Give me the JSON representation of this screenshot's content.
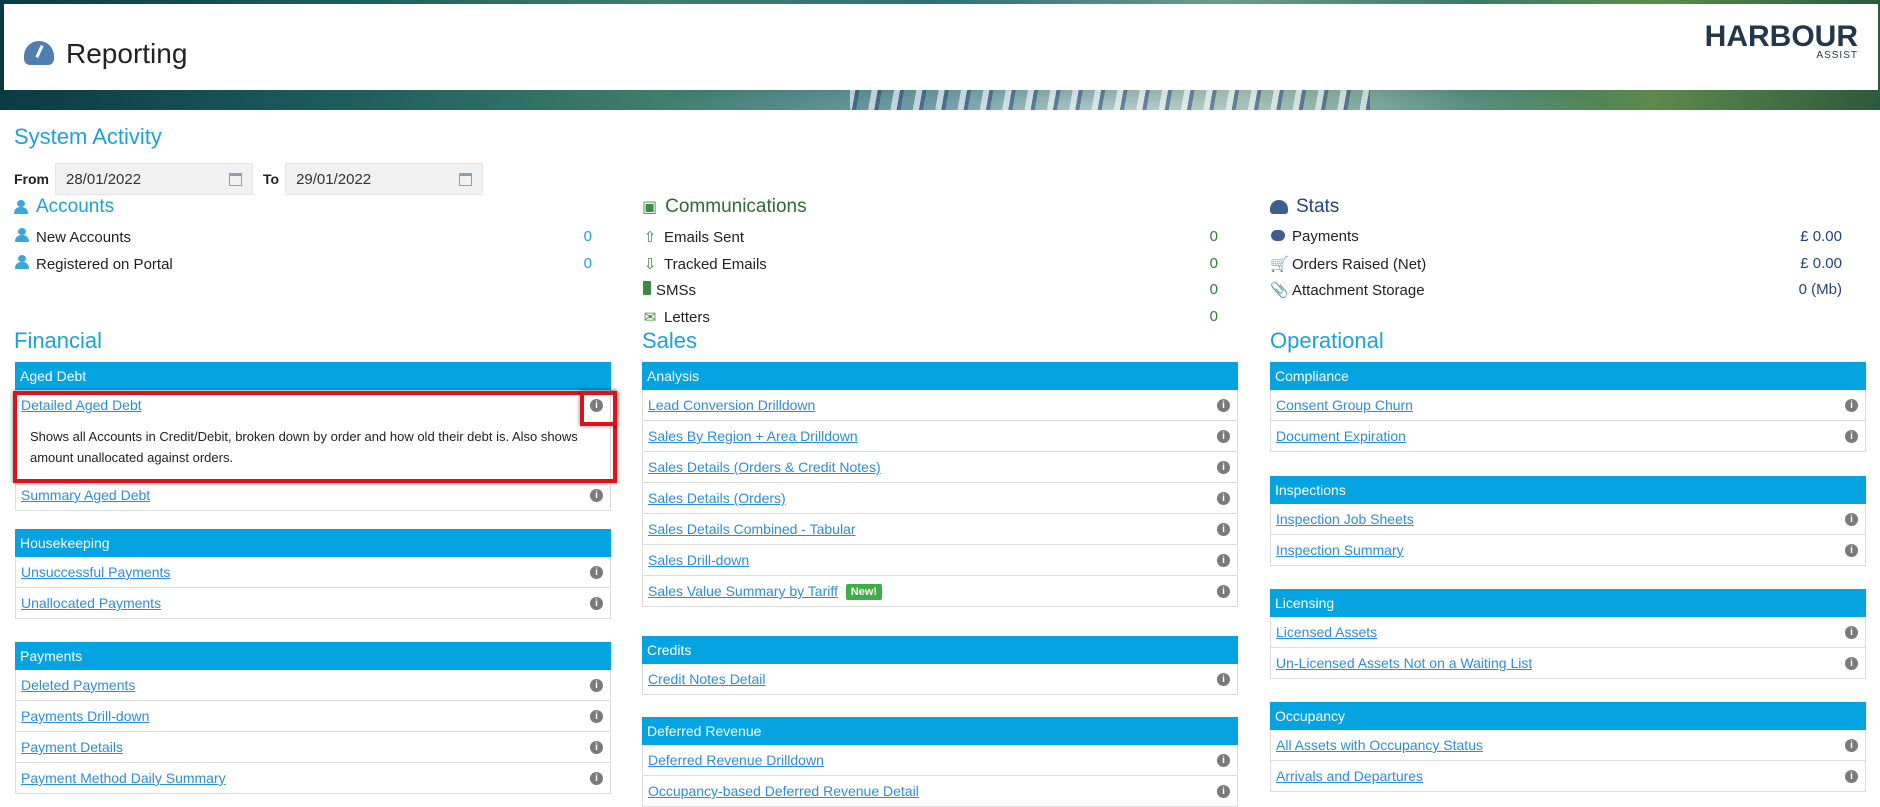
{
  "header": {
    "title": "Reporting",
    "logo_main": "HARBOUR",
    "logo_sub": "ASSIST"
  },
  "system_activity": {
    "heading": "System Activity",
    "from_label": "From",
    "from_value": "28/01/2022",
    "to_label": "To",
    "to_value": "29/01/2022"
  },
  "accounts": {
    "title": "Accounts",
    "rows": [
      {
        "label": "New Accounts",
        "value": "0"
      },
      {
        "label": "Registered on Portal",
        "value": "0"
      }
    ]
  },
  "communications": {
    "title": "Communications",
    "rows": [
      {
        "label": "Emails Sent",
        "value": "0"
      },
      {
        "label": "Tracked Emails",
        "value": "0"
      },
      {
        "label": "SMSs",
        "value": "0"
      },
      {
        "label": "Letters",
        "value": "0"
      }
    ]
  },
  "stats": {
    "title": "Stats",
    "rows": [
      {
        "label": "Payments",
        "value": "£ 0.00"
      },
      {
        "label": "Orders Raised (Net)",
        "value": "£ 0.00"
      },
      {
        "label": "Attachment Storage",
        "value": "0 (Mb)"
      }
    ]
  },
  "financial": {
    "heading": "Financial",
    "aged_debt": {
      "header": "Aged Debt",
      "items": [
        "Detailed Aged Debt",
        "Summary Aged Debt"
      ],
      "description": "Shows all Accounts in Credit/Debit, broken down by order and how old their debt is. Also shows amount unallocated against orders."
    },
    "housekeeping": {
      "header": "Housekeeping",
      "items": [
        "Unsuccessful Payments",
        "Unallocated Payments"
      ]
    },
    "payments": {
      "header": "Payments",
      "items": [
        "Deleted Payments",
        "Payments Drill-down",
        "Payment Details",
        "Payment Method Daily Summary"
      ]
    }
  },
  "sales": {
    "heading": "Sales",
    "analysis": {
      "header": "Analysis",
      "items": [
        "Lead Conversion Drilldown",
        "Sales By Region + Area Drilldown",
        "Sales Details (Orders & Credit Notes)",
        "Sales Details (Orders)",
        "Sales Details Combined - Tabular",
        "Sales Drill-down",
        "Sales Value Summary by Tariff"
      ],
      "new_badge": "New!"
    },
    "credits": {
      "header": "Credits",
      "items": [
        "Credit Notes Detail"
      ]
    },
    "deferred": {
      "header": "Deferred Revenue",
      "items": [
        "Deferred Revenue Drilldown",
        "Occupancy-based Deferred Revenue Detail"
      ]
    }
  },
  "operational": {
    "heading": "Operational",
    "compliance": {
      "header": "Compliance",
      "items": [
        "Consent Group Churn",
        "Document Expiration"
      ]
    },
    "inspections": {
      "header": "Inspections",
      "items": [
        "Inspection Job Sheets",
        "Inspection Summary"
      ]
    },
    "licensing": {
      "header": "Licensing",
      "items": [
        "Licensed Assets",
        "Un-Licensed Assets Not on a Waiting List"
      ]
    },
    "occupancy": {
      "header": "Occupancy",
      "items": [
        "All Assets with Occupancy Status",
        "Arrivals and Departures"
      ]
    }
  },
  "colors": {
    "accent": "#04a4e2",
    "heading": "#1aa3d9",
    "comm_green": "#2e7d32",
    "stats_navy": "#23457a",
    "link": "#2a8fd6",
    "highlight": "#d9141b"
  }
}
